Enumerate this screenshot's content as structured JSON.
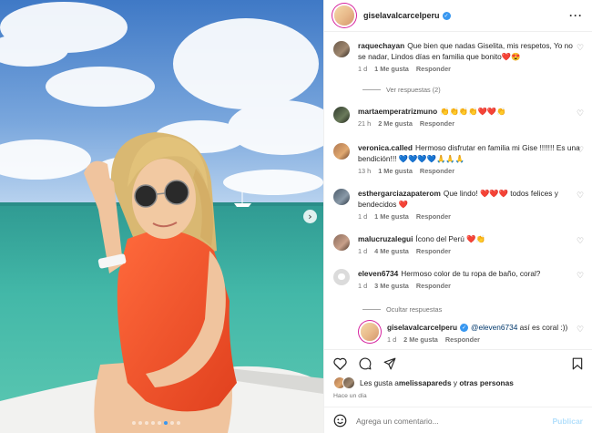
{
  "post": {
    "author": "giselavalcarcelperu",
    "carousel_slides": 8,
    "carousel_active": 5
  },
  "comments": [
    {
      "user": "raquechayan",
      "text": "Que bien que nadas Giselita, mis respetos, Yo no se nadar, Lindos días en familia que bonito❤️😍",
      "time": "1 d",
      "likes": "1 Me gusta",
      "reply": "Responder"
    },
    {
      "user": "martaemperatrizmuno",
      "text": "👏👏👏👏❤️❤️👏",
      "time": "21 h",
      "likes": "2 Me gusta",
      "reply": "Responder"
    },
    {
      "user": "veronica.called",
      "text": "Hermoso disfrutar en familia mi Gise !!!!!!! Es una bendición!!! 💙💙💙💙🙏🙏🙏",
      "time": "13 h",
      "likes": "1 Me gusta",
      "reply": "Responder"
    },
    {
      "user": "esthergarciazapaterom",
      "text": "Que lindo! ❤️❤️❤️ todos felices y bendecidos ❤️",
      "time": "1 d",
      "likes": "1 Me gusta",
      "reply": "Responder"
    },
    {
      "user": "malucruzalegui",
      "text": "Ícono del Perú ❤️👏",
      "time": "1 d",
      "likes": "4 Me gusta",
      "reply": "Responder"
    },
    {
      "user": "eleven6734",
      "text": "Hermoso color de tu ropa de baño, coral?",
      "time": "1 d",
      "likes": "3 Me gusta",
      "reply": "Responder"
    }
  ],
  "view_replies": "Ver respuestas (2)",
  "hide_replies": "Ocultar respuestas",
  "reply": {
    "user": "giselavalcarcelperu",
    "mention": "@eleven6734",
    "text": " así es coral :))",
    "time": "1 d",
    "likes": "2 Me gusta",
    "reply_label": "Responder"
  },
  "likes_line": {
    "prefix": "Les gusta a ",
    "user": "melissapareds",
    "suffix": " y ",
    "others": "otras personas"
  },
  "time_ago": "Hace un día",
  "comment_input": {
    "placeholder": "Agrega un comentario..."
  },
  "publish_label": "Publicar",
  "colors": {
    "accent": "#3897f0",
    "swimsuit": "#f0502a",
    "publish": "#b2dffc"
  }
}
